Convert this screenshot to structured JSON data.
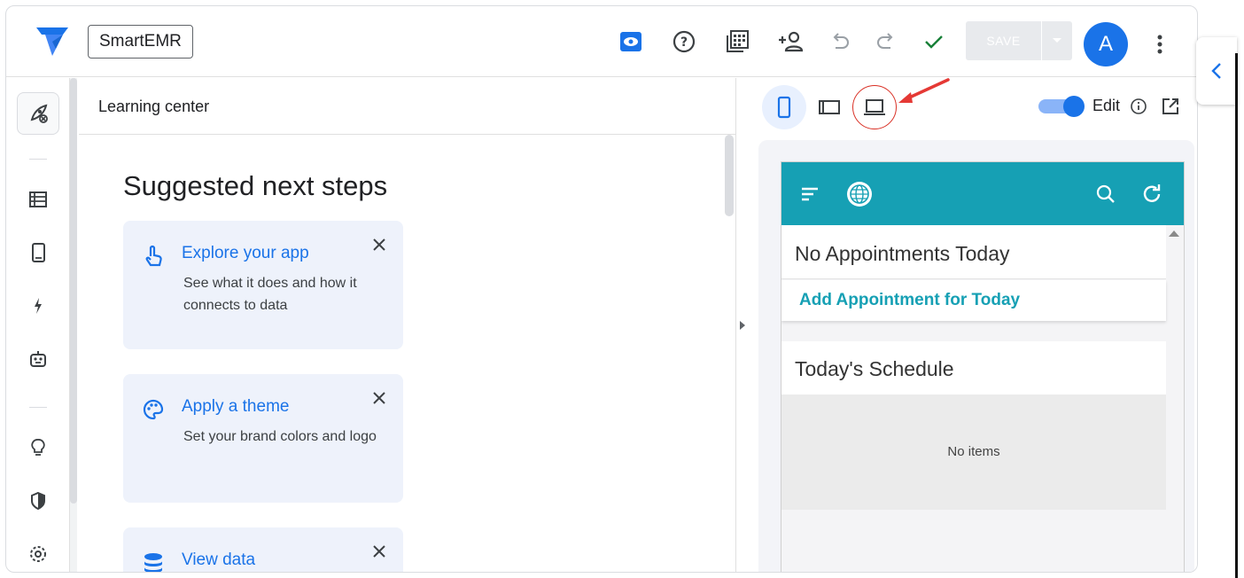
{
  "app": {
    "name": "SmartEMR",
    "logo_icon": "appsheet-logo-icon",
    "accent_color": "#1a73e8"
  },
  "toolbar": {
    "icons": [
      "preview-eye-icon",
      "help-icon",
      "gallery-icon",
      "share-user-icon",
      "undo-icon",
      "redo-icon",
      "check-icon"
    ],
    "save_label": "SAVE",
    "save_dropdown_icon": "caret-down-icon",
    "avatar_letter": "A",
    "more_icon": "kebab-menu-icon"
  },
  "rail": {
    "items": [
      "rocket-icon",
      "data-table-icon",
      "mobile-view-icon",
      "automation-bolt-icon",
      "bot-icon",
      "lightbulb-icon",
      "security-shield-icon",
      "settings-gear-icon"
    ]
  },
  "learning": {
    "header": "Learning center",
    "title": "Suggested next steps",
    "cards": [
      {
        "title": "Explore your app",
        "desc": "See what it does and how it connects to data",
        "icon": "touch-hand-icon"
      },
      {
        "title": "Apply a theme",
        "desc": "Set your brand colors and logo",
        "icon": "palette-icon"
      },
      {
        "title": "View data",
        "desc": "",
        "icon": "database-icon"
      }
    ]
  },
  "preview": {
    "devices": [
      "mobile-device-icon",
      "tablet-device-icon",
      "desktop-device-icon"
    ],
    "active_device": "mobile",
    "edit_label": "Edit",
    "edit_toggle_on": true,
    "app_header_color": "#16a0b4",
    "sections": {
      "no_appointments": "No Appointments Today",
      "add_appointment": "Add Appointment for Today",
      "schedule_title": "Today's Schedule",
      "empty_text": "No items"
    }
  }
}
